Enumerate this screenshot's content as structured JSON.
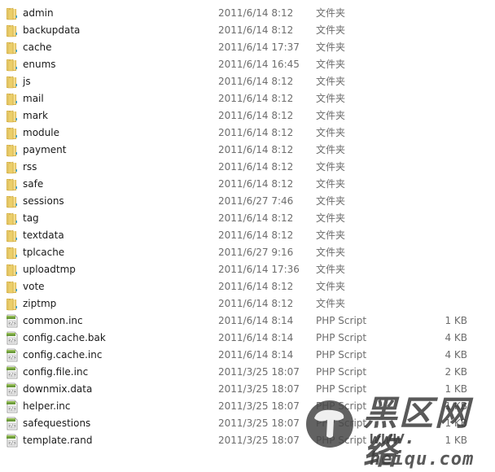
{
  "files": [
    {
      "name": "admin",
      "date": "2011/6/14 8:12",
      "type": "文件夹",
      "size": "",
      "icon": "folder-icon"
    },
    {
      "name": "backupdata",
      "date": "2011/6/14 8:12",
      "type": "文件夹",
      "size": "",
      "icon": "folder-icon"
    },
    {
      "name": "cache",
      "date": "2011/6/14 17:37",
      "type": "文件夹",
      "size": "",
      "icon": "folder-icon"
    },
    {
      "name": "enums",
      "date": "2011/6/14 16:45",
      "type": "文件夹",
      "size": "",
      "icon": "folder-icon"
    },
    {
      "name": "js",
      "date": "2011/6/14 8:12",
      "type": "文件夹",
      "size": "",
      "icon": "folder-icon"
    },
    {
      "name": "mail",
      "date": "2011/6/14 8:12",
      "type": "文件夹",
      "size": "",
      "icon": "folder-icon"
    },
    {
      "name": "mark",
      "date": "2011/6/14 8:12",
      "type": "文件夹",
      "size": "",
      "icon": "folder-icon"
    },
    {
      "name": "module",
      "date": "2011/6/14 8:12",
      "type": "文件夹",
      "size": "",
      "icon": "folder-icon"
    },
    {
      "name": "payment",
      "date": "2011/6/14 8:12",
      "type": "文件夹",
      "size": "",
      "icon": "folder-icon"
    },
    {
      "name": "rss",
      "date": "2011/6/14 8:12",
      "type": "文件夹",
      "size": "",
      "icon": "folder-icon"
    },
    {
      "name": "safe",
      "date": "2011/6/14 8:12",
      "type": "文件夹",
      "size": "",
      "icon": "folder-icon"
    },
    {
      "name": "sessions",
      "date": "2011/6/27 7:46",
      "type": "文件夹",
      "size": "",
      "icon": "folder-icon"
    },
    {
      "name": "tag",
      "date": "2011/6/14 8:12",
      "type": "文件夹",
      "size": "",
      "icon": "folder-icon"
    },
    {
      "name": "textdata",
      "date": "2011/6/14 8:12",
      "type": "文件夹",
      "size": "",
      "icon": "folder-icon"
    },
    {
      "name": "tplcache",
      "date": "2011/6/27 9:16",
      "type": "文件夹",
      "size": "",
      "icon": "folder-icon"
    },
    {
      "name": "uploadtmp",
      "date": "2011/6/14 17:36",
      "type": "文件夹",
      "size": "",
      "icon": "folder-icon"
    },
    {
      "name": "vote",
      "date": "2011/6/14 8:12",
      "type": "文件夹",
      "size": "",
      "icon": "folder-icon"
    },
    {
      "name": "ziptmp",
      "date": "2011/6/14 8:12",
      "type": "文件夹",
      "size": "",
      "icon": "folder-icon"
    },
    {
      "name": "common.inc",
      "date": "2011/6/14 8:14",
      "type": "PHP Script",
      "size": "1 KB",
      "icon": "php-script-icon"
    },
    {
      "name": "config.cache.bak",
      "date": "2011/6/14 8:14",
      "type": "PHP Script",
      "size": "4 KB",
      "icon": "php-script-icon"
    },
    {
      "name": "config.cache.inc",
      "date": "2011/6/14 8:14",
      "type": "PHP Script",
      "size": "4 KB",
      "icon": "php-script-icon"
    },
    {
      "name": "config.file.inc",
      "date": "2011/3/25 18:07",
      "type": "PHP Script",
      "size": "2 KB",
      "icon": "php-script-icon"
    },
    {
      "name": "downmix.data",
      "date": "2011/3/25 18:07",
      "type": "PHP Script",
      "size": "1 KB",
      "icon": "php-script-icon"
    },
    {
      "name": "helper.inc",
      "date": "2011/3/25 18:07",
      "type": "PHP Script",
      "size": "1 KB",
      "icon": "php-script-icon"
    },
    {
      "name": "safequestions",
      "date": "2011/3/25 18:07",
      "type": "PHP Script",
      "size": "1 KB",
      "icon": "php-script-icon"
    },
    {
      "name": "template.rand",
      "date": "2011/3/25 18:07",
      "type": "PHP Script",
      "size": "1 KB",
      "icon": "php-script-icon"
    }
  ],
  "watermark": {
    "title": "黑区网络",
    "url": "www. heiqu.com"
  },
  "colors": {
    "folder": "#e8c85a",
    "script_green": "#6a9a3a",
    "meta_text": "#6d6d6d"
  }
}
